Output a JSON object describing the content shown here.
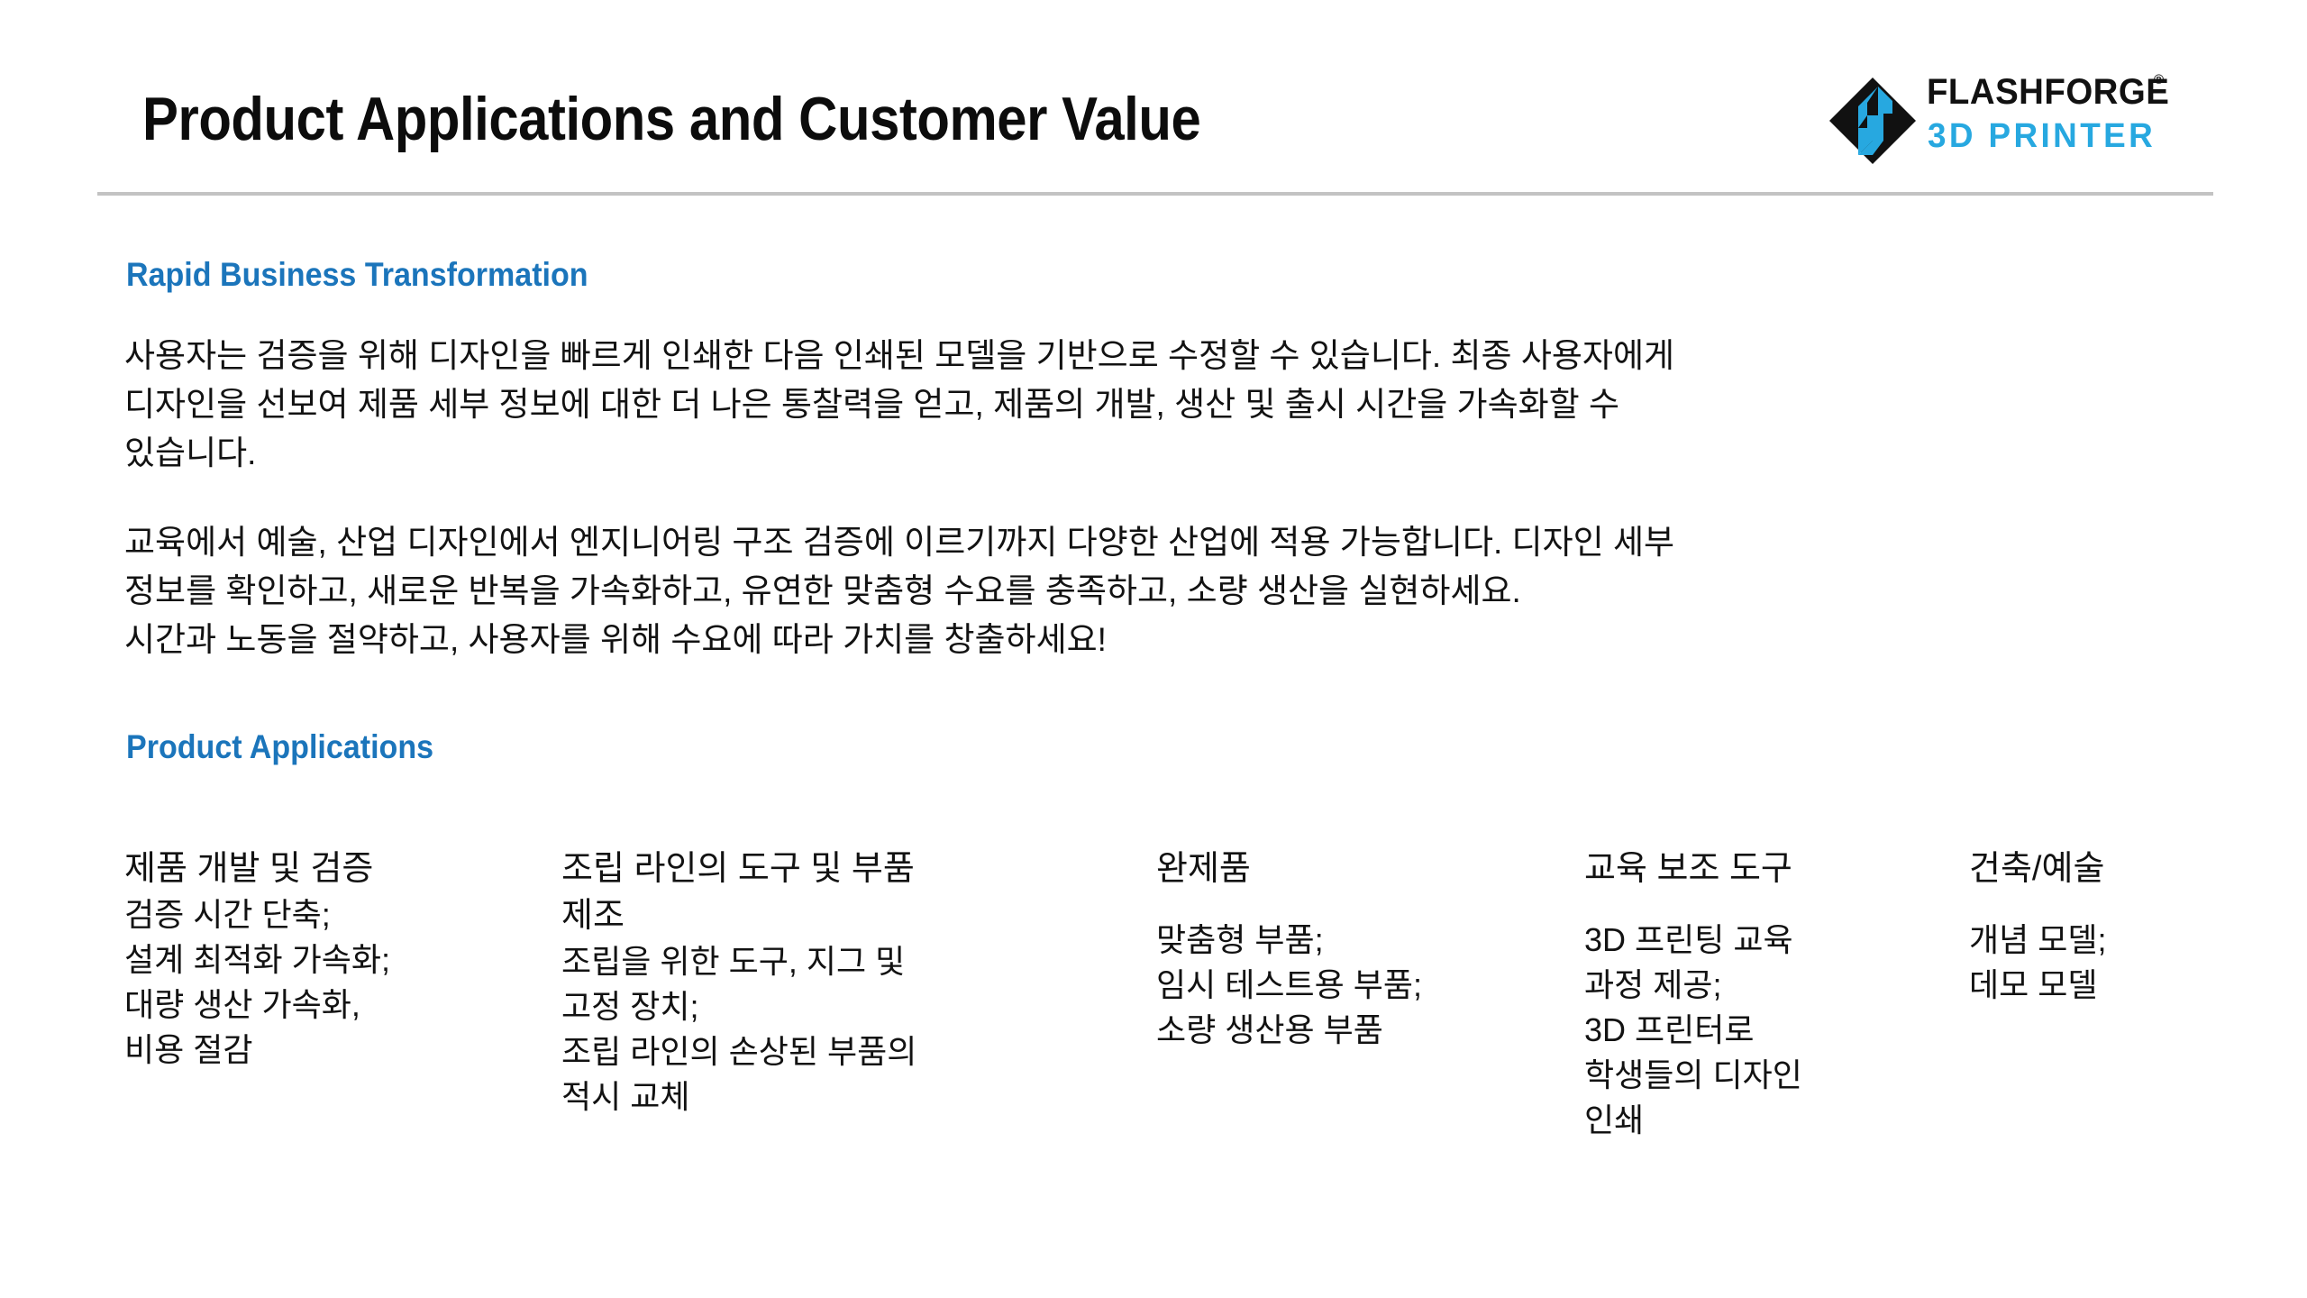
{
  "slide": {
    "title": "Product Applications and Customer Value"
  },
  "logo": {
    "wordmark": "FLASHFORGE",
    "registered_mark": "®",
    "subtitle": "3D PRINTER",
    "mark_color": "#27a8e0",
    "mark_dark": "#111111"
  },
  "colors": {
    "heading_blue": "#1b75bb",
    "logo_cyan": "#27a8e0",
    "rule_gray": "#c3c3c3",
    "body_text": "#121212"
  },
  "sections": {
    "rapid_business": {
      "heading": "Rapid Business Transformation",
      "paragraph_1": "사용자는 검증을 위해 디자인을 빠르게 인쇄한 다음 인쇄된 모델을 기반으로 수정할 수 있습니다. 최종 사용자에게\n디자인을 선보여 제품 세부 정보에 대한 더 나은 통찰력을 얻고, 제품의 개발, 생산 및 출시 시간을 가속화할 수\n있습니다.",
      "paragraph_2": "교육에서 예술, 산업 디자인에서 엔지니어링 구조 검증에 이르기까지 다양한 산업에 적용 가능합니다. 디자인 세부\n정보를 확인하고, 새로운 반복을 가속화하고, 유연한 맞춤형 수요를 충족하고, 소량 생산을 실현하세요.\n시간과 노동을 절약하고, 사용자를 위해 수요에 따라 가치를 창출하세요!"
    },
    "product_applications": {
      "heading": "Product Applications",
      "columns": [
        {
          "title": "제품 개발 및 검증",
          "items": "검증 시간 단축;\n설계 최적화 가속화;\n대량 생산 가속화,\n비용 절감",
          "spaced": false
        },
        {
          "title": "조립 라인의 도구 및 부품\n제조",
          "items": "조립을 위한 도구, 지그 및\n고정 장치;\n조립 라인의 손상된 부품의\n적시 교체",
          "spaced": false
        },
        {
          "title": "완제품",
          "items": "맞춤형 부품;\n임시 테스트용 부품;\n소량 생산용 부품",
          "spaced": true
        },
        {
          "title": "교육 보조 도구",
          "items": "3D 프린팅 교육\n과정 제공;\n3D 프린터로\n학생들의 디자인\n인쇄",
          "spaced": true
        },
        {
          "title": "건축/예술",
          "items": "개념 모델;\n데모 모델",
          "spaced": true
        }
      ]
    }
  }
}
